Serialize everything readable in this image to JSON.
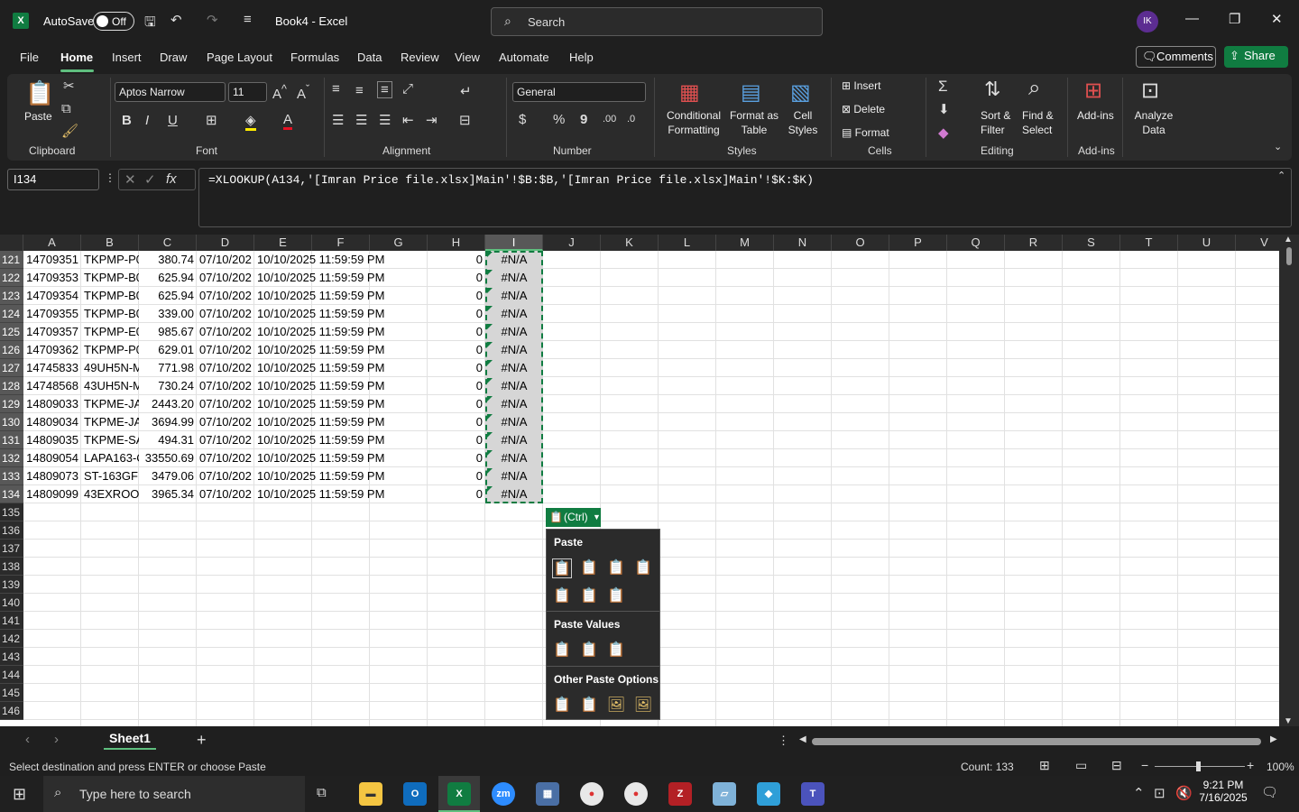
{
  "titlebar": {
    "autosave_label": "AutoSave",
    "autosave_state": "Off",
    "doc_title": "Book4 - Excel",
    "search_placeholder": "Search",
    "avatar_initials": "IK"
  },
  "menu": {
    "items": [
      "File",
      "Home",
      "Insert",
      "Draw",
      "Page Layout",
      "Formulas",
      "Data",
      "Review",
      "View",
      "Automate",
      "Help"
    ],
    "active": "Home",
    "comments_label": "Comments",
    "share_label": "Share"
  },
  "ribbon": {
    "clipboard": {
      "paste_label": "Paste",
      "group_label": "Clipboard"
    },
    "font": {
      "font_name": "Aptos Narrow",
      "font_size": "11",
      "group_label": "Font"
    },
    "alignment": {
      "group_label": "Alignment"
    },
    "number": {
      "format": "General",
      "group_label": "Number"
    },
    "styles": {
      "conditional_formatting": [
        "Conditional",
        "Formatting"
      ],
      "format_as_table": [
        "Format as",
        "Table"
      ],
      "cell_styles": [
        "Cell",
        "Styles"
      ],
      "group_label": "Styles"
    },
    "cells": {
      "insert": "Insert",
      "delete": "Delete",
      "format": "Format",
      "group_label": "Cells"
    },
    "editing": {
      "sort_filter": [
        "Sort &",
        "Filter"
      ],
      "find_select": [
        "Find &",
        "Select"
      ],
      "group_label": "Editing"
    },
    "addins": {
      "label": "Add-ins",
      "group_label": "Add-ins"
    },
    "analyze": {
      "label": [
        "Analyze",
        "Data"
      ]
    }
  },
  "formula_bar": {
    "name_box": "I134",
    "formula": "=XLOOKUP(A134,'[Imran Price file.xlsx]Main'!$B:$B,'[Imran Price file.xlsx]Main'!$K:$K)"
  },
  "grid": {
    "columns": [
      "A",
      "B",
      "C",
      "D",
      "E",
      "F",
      "G",
      "H",
      "I",
      "J",
      "K",
      "L",
      "M",
      "N",
      "O",
      "P",
      "Q",
      "R",
      "S",
      "T",
      "U",
      "V"
    ],
    "selected_column": "I",
    "rows": [
      {
        "n": "121",
        "a": "14709351",
        "b": "TKPMP-P0",
        "c": "380.74",
        "d": "07/10/202",
        "e": "10/10/2025 11:59:59 PM",
        "h": "0",
        "i": "#N/A"
      },
      {
        "n": "122",
        "a": "14709353",
        "b": "TKPMP-B0",
        "c": "625.94",
        "d": "07/10/202",
        "e": "10/10/2025 11:59:59 PM",
        "h": "0",
        "i": "#N/A"
      },
      {
        "n": "123",
        "a": "14709354",
        "b": "TKPMP-B0",
        "c": "625.94",
        "d": "07/10/202",
        "e": "10/10/2025 11:59:59 PM",
        "h": "0",
        "i": "#N/A"
      },
      {
        "n": "124",
        "a": "14709355",
        "b": "TKPMP-B0",
        "c": "339.00",
        "d": "07/10/202",
        "e": "10/10/2025 11:59:59 PM",
        "h": "0",
        "i": "#N/A"
      },
      {
        "n": "125",
        "a": "14709357",
        "b": "TKPMP-E0",
        "c": "985.67",
        "d": "07/10/202",
        "e": "10/10/2025 11:59:59 PM",
        "h": "0",
        "i": "#N/A"
      },
      {
        "n": "126",
        "a": "14709362",
        "b": "TKPMP-P0",
        "c": "629.01",
        "d": "07/10/202",
        "e": "10/10/2025 11:59:59 PM",
        "h": "0",
        "i": "#N/A"
      },
      {
        "n": "127",
        "a": "14745833",
        "b": "49UH5N-M",
        "c": "771.98",
        "d": "07/10/202",
        "e": "10/10/2025 11:59:59 PM",
        "h": "0",
        "i": "#N/A"
      },
      {
        "n": "128",
        "a": "14748568",
        "b": "43UH5N-M",
        "c": "730.24",
        "d": "07/10/202",
        "e": "10/10/2025 11:59:59 PM",
        "h": "0",
        "i": "#N/A"
      },
      {
        "n": "129",
        "a": "14809033",
        "b": "TKPME-JAI",
        "c": "2443.20",
        "d": "07/10/202",
        "e": "10/10/2025 11:59:59 PM",
        "h": "0",
        "i": "#N/A"
      },
      {
        "n": "130",
        "a": "14809034",
        "b": "TKPME-JAI",
        "c": "3694.99",
        "d": "07/10/202",
        "e": "10/10/2025 11:59:59 PM",
        "h": "0",
        "i": "#N/A"
      },
      {
        "n": "131",
        "a": "14809035",
        "b": "TKPME-SA",
        "c": "494.31",
        "d": "07/10/202",
        "e": "10/10/2025 11:59:59 PM",
        "h": "0",
        "i": "#N/A"
      },
      {
        "n": "132",
        "a": "14809054",
        "b": "LAPA163-C",
        "c": "33550.69",
        "d": "07/10/202",
        "e": "10/10/2025 11:59:59 PM",
        "h": "0",
        "i": "#N/A"
      },
      {
        "n": "133",
        "a": "14809073",
        "b": "ST-163GF",
        "c": "3479.06",
        "d": "07/10/202",
        "e": "10/10/2025 11:59:59 PM",
        "h": "0",
        "i": "#N/A"
      },
      {
        "n": "134",
        "a": "14809099",
        "b": "43EXROOI",
        "c": "3965.34",
        "d": "07/10/202",
        "e": "10/10/2025 11:59:59 PM",
        "h": "0",
        "i": "#N/A"
      }
    ],
    "empty_rows": [
      "135",
      "136",
      "137",
      "138",
      "139",
      "140",
      "141",
      "142",
      "143",
      "144",
      "145",
      "146"
    ]
  },
  "paste_popup": {
    "ctrl_label": "(Ctrl)",
    "paste_header": "Paste",
    "paste_values_header": "Paste Values",
    "other_header": "Other Paste Options"
  },
  "sheets": {
    "tabs": [
      "Sheet1"
    ]
  },
  "status": {
    "message": "Select destination and press ENTER or choose Paste",
    "count": "Count: 133",
    "zoom": "100%"
  },
  "taskbar": {
    "search_placeholder": "Type here to search",
    "time": "9:21 PM",
    "date": "7/16/2025"
  }
}
